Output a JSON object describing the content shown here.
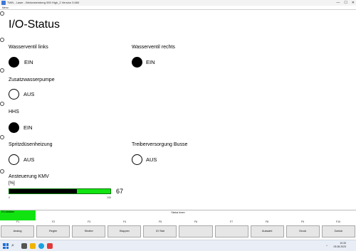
{
  "window": {
    "title": "TWN - Laser - Brinkesteinberg 550 High_2 Version 3.660",
    "menu": "Menu",
    "controls": [
      "—",
      "☐",
      "✕"
    ]
  },
  "page": {
    "title": "I/O-Status"
  },
  "io": {
    "wasserventil_links": {
      "label": "Wasserventil links",
      "state": "EIN",
      "on": true
    },
    "wasserventil_rechts": {
      "label": "Wasserventil rechts",
      "state": "EIN",
      "on": true
    },
    "zusatzwasserpumpe": {
      "label": "Zusatzwasserpumpe",
      "state": "AUS",
      "on": false
    },
    "hhs": {
      "label": "HHS",
      "state": "EIN",
      "on": true
    },
    "spritzduesenheizung": {
      "label": "Spritzdüsenheizung",
      "state": "AUS",
      "on": false
    },
    "treiberversorgung_busse": {
      "label": "Treiberversorgung Busse",
      "state": "AUS",
      "on": false
    }
  },
  "kmv": {
    "label": "Ansteuerung KMV",
    "unit": "[%]",
    "value": 67,
    "value_text": "67",
    "min_label": "0",
    "max_label": "100",
    "colors": {
      "fill": "#000000",
      "track": "#12e312"
    }
  },
  "status": {
    "left_text": "ES Abbilder",
    "center_text": "Status lesen",
    "left_color": "#11e311"
  },
  "fkeys": [
    "F1",
    "F2",
    "F3",
    "F4",
    "F5",
    "F6",
    "F7",
    "F8",
    "F9",
    "F10"
  ],
  "fbuttons": [
    "Analog",
    "Regler",
    "Shutter",
    "Klappen",
    "IO Stat",
    "",
    "",
    "Auswahl",
    "Druck",
    "Zurück"
  ],
  "taskbar": {
    "search_icon": "search-icon",
    "time": "10:33",
    "date": "03.08.2023",
    "tray": "^"
  }
}
